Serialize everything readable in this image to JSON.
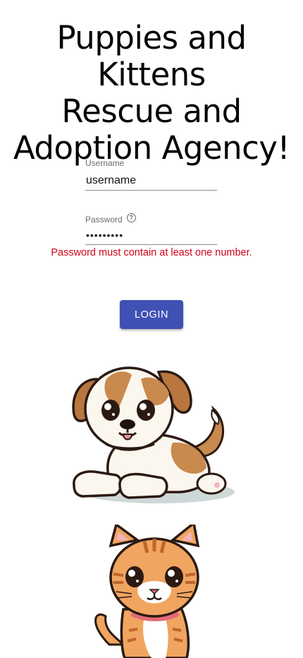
{
  "header": {
    "title_line1": "Puppies and Kittens",
    "title_line2": "Rescue and",
    "title_line3": "Adoption Agency!"
  },
  "login_form": {
    "username_label": "Username",
    "username_value": "username",
    "password_label": "Password",
    "password_value": "•••••••••",
    "help_icon": "help-circle-icon",
    "error_message": "Password must contain at least one number.",
    "submit_label": "LOGIN"
  },
  "images": {
    "puppy": "cartoon-puppy",
    "kitten": "cartoon-kitten"
  },
  "colors": {
    "primary_button": "#3f51b5",
    "error_text": "#d0021b"
  }
}
